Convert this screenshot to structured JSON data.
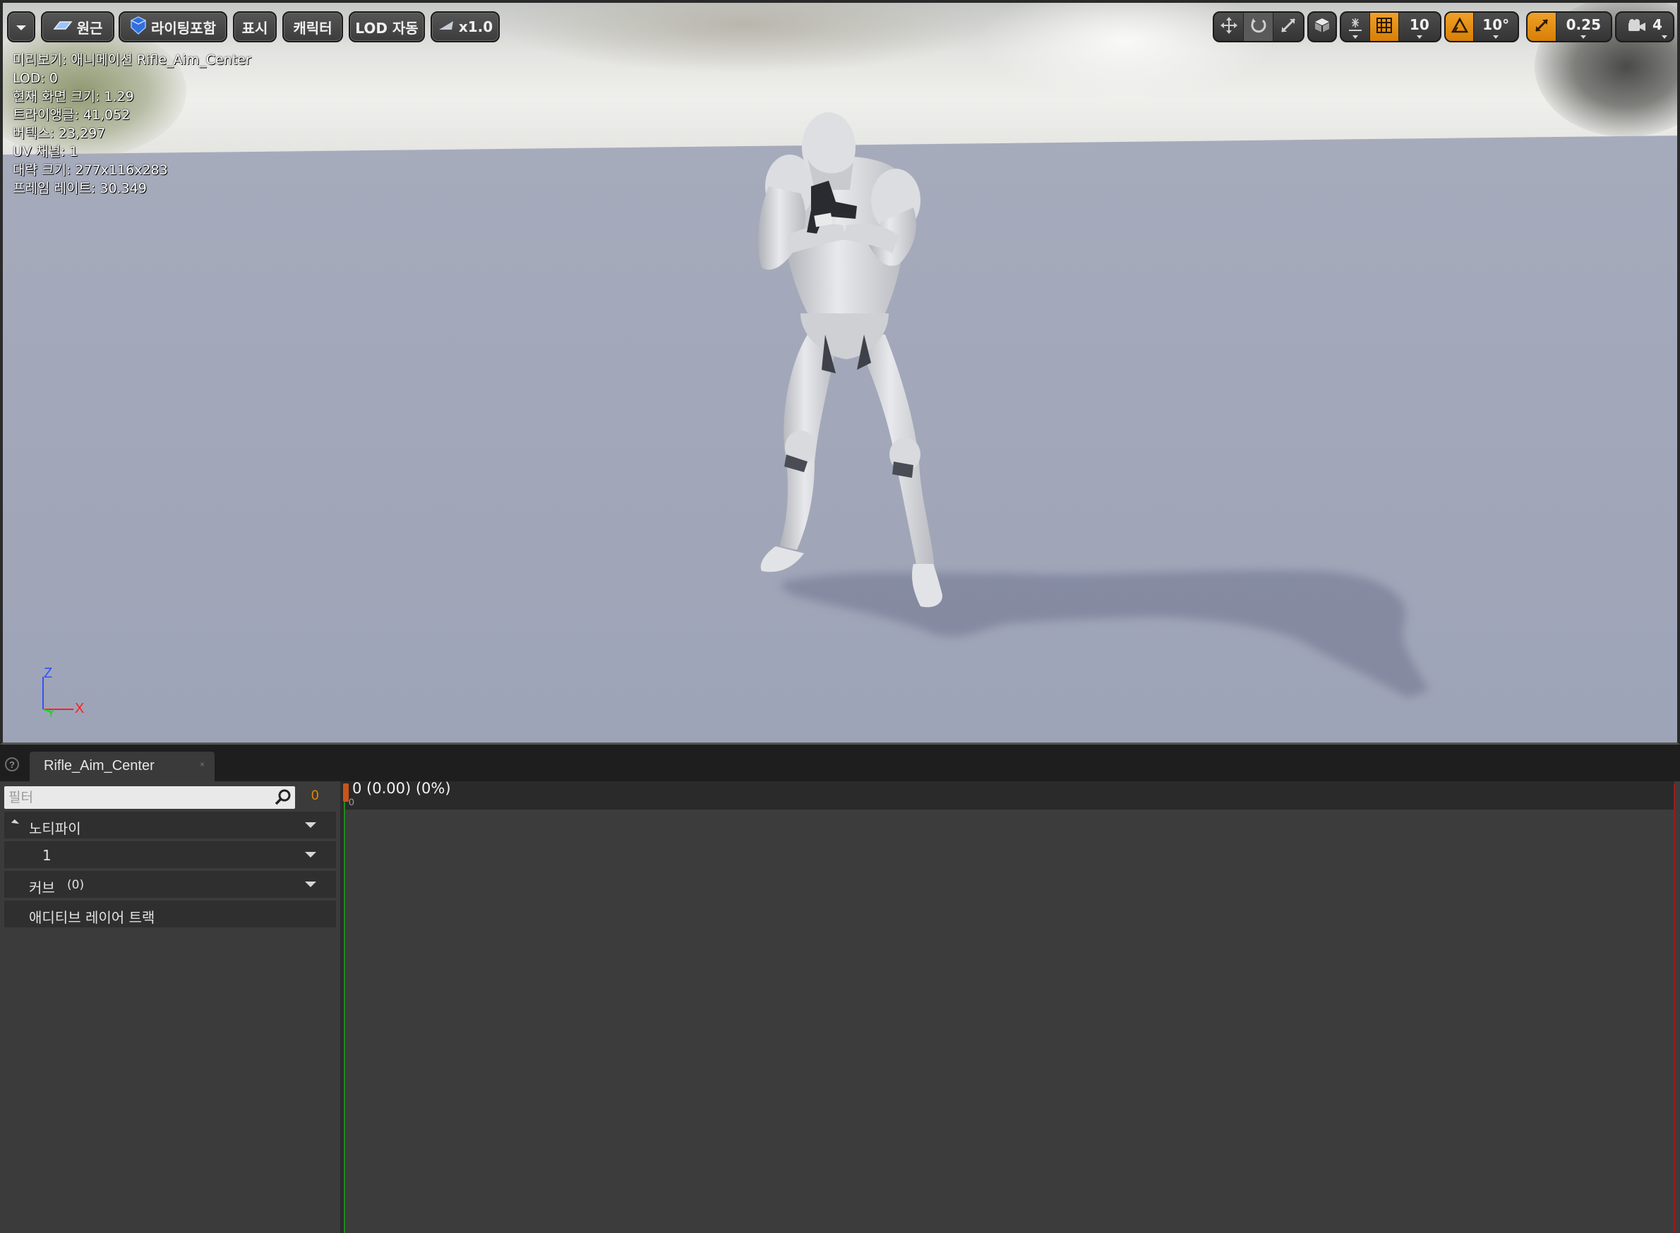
{
  "viewport": {
    "toolbar": {
      "menu_caret_label": "",
      "view_mode_label": "원근",
      "lighting_label": "라이팅포함",
      "show_label": "표시",
      "character_label": "캐릭터",
      "lod_label": "LOD 자동",
      "speed_label": "x1.0",
      "grid_snap_value": "10",
      "rotation_snap_value": "10°",
      "scale_snap_value": "0.25",
      "camera_speed_value": "4",
      "accent_orange": "#e08a0c",
      "icons": {
        "translate": "move-arrows-icon",
        "rotate": "rotate-icon",
        "scale": "scale-arrows-icon",
        "world_local": "cube-icon",
        "surface_snap": "surface-snap-icon",
        "grid": "grid-icon",
        "angle": "triangle-angle-icon",
        "scale_snap": "scale-snap-icon",
        "camera": "camera-icon"
      }
    },
    "stats": [
      "미리보기: 애니메이션 Rifle_Aim_Center",
      "LOD: 0",
      "현재 화면 크기: 1.29",
      "트라이앵글: 41,052",
      "버텍스: 23,297",
      "UV 채널: 1",
      "대략 크기: 277x116x283",
      "프레임 레이트: 30.349"
    ],
    "axis_gizmo": {
      "z": "Z",
      "x": "X",
      "y": "Y"
    }
  },
  "tab": {
    "title": "Rifle_Aim_Center",
    "close": "×"
  },
  "track_panel": {
    "filter_placeholder": "필터",
    "frame_count": "0",
    "notifies_label": "노티파이",
    "notify_track_1": "1",
    "curves_label": "커브",
    "curves_count": "(0)",
    "additive_layer_label": "애디티브 레이어 트랙"
  },
  "timeline": {
    "readout": "0 (0.00) (0%)",
    "ruler_zero": "0"
  }
}
